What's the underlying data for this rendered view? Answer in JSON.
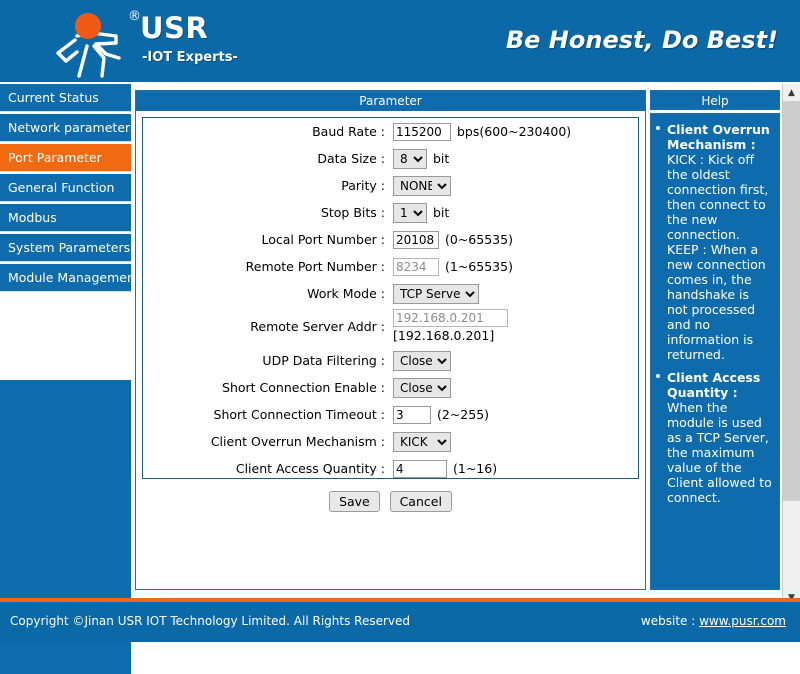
{
  "header": {
    "brand": "USR",
    "tagline": "-IOT Experts-",
    "slogan": "Be Honest, Do Best!",
    "logo_icon": "usr-running-man-logo",
    "registered_mark": "®",
    "bg_color": "#0c69a8"
  },
  "sidebar": {
    "items": [
      {
        "label": "Current Status",
        "active": false
      },
      {
        "label": "Network parameters",
        "active": false
      },
      {
        "label": "Port Parameter",
        "active": true
      },
      {
        "label": "General Function",
        "active": false
      },
      {
        "label": "Modbus",
        "active": false
      },
      {
        "label": "System Parameters",
        "active": false
      },
      {
        "label": "Module Management",
        "active": false
      }
    ],
    "active_color": "#f26a0f",
    "item_color": "#0f6cac"
  },
  "main": {
    "panel_title": "Parameter",
    "fields": [
      {
        "label": "Baud Rate :",
        "type": "text",
        "value": "115200",
        "hint": "bps(600~230400)",
        "disabled": false,
        "width": "w-baud"
      },
      {
        "label": "Data Size :",
        "type": "select",
        "value": "8",
        "hint": "bit",
        "width": "s-num"
      },
      {
        "label": "Parity :",
        "type": "select",
        "value": "NONE",
        "hint": "",
        "width": "s-mid"
      },
      {
        "label": "Stop Bits :",
        "type": "select",
        "value": "1",
        "hint": "bit",
        "width": "s-num"
      },
      {
        "label": "Local Port Number :",
        "type": "text",
        "value": "20108",
        "hint": "(0~65535)",
        "disabled": false,
        "width": "w-port"
      },
      {
        "label": "Remote Port Number :",
        "type": "text",
        "value": "8234",
        "hint": "(1~65535)",
        "disabled": true,
        "width": "w-port"
      },
      {
        "label": "Work Mode :",
        "type": "select",
        "value": "TCP Server",
        "hint": "",
        "width": "s-wide"
      },
      {
        "label": "Remote Server Addr :",
        "type": "addr",
        "value": "192.168.0.201",
        "note": "[192.168.0.201]",
        "disabled": true,
        "width": "w-addr"
      },
      {
        "label": "UDP Data Filtering :",
        "type": "select",
        "value": "Close",
        "hint": "",
        "width": "s-mid"
      },
      {
        "label": "Short Connection Enable :",
        "type": "select",
        "value": "Close",
        "hint": "",
        "width": "s-mid"
      },
      {
        "label": "Short Connection Timeout :",
        "type": "text",
        "value": "3",
        "hint": "(2~255)",
        "disabled": false,
        "width": "w-small"
      },
      {
        "label": "Client Overrun Mechanism :",
        "type": "select",
        "value": "KICK",
        "hint": "",
        "width": "s-mid"
      },
      {
        "label": "Client Access Quantity :",
        "type": "text",
        "value": "4",
        "hint": "(1~16)",
        "disabled": false,
        "width": "w-qty"
      }
    ],
    "save_label": "Save",
    "cancel_label": "Cancel"
  },
  "help": {
    "title": "Help",
    "groups": [
      {
        "heading": "Client Overrun Mechanism :",
        "body": "KICK : Kick off the oldest connection first, then connect to the new connection. KEEP : When a new connection comes in, the handshake is not processed and no information is returned."
      },
      {
        "heading": "Client Access Quantity :",
        "body": "When the module is used as a TCP Server, the maximum value of the Client allowed to connect."
      }
    ]
  },
  "scrollbar": {
    "up_icon": "chevron-up-icon",
    "down_icon": "chevron-down-icon"
  },
  "footer": {
    "copyright": "Copyright ©Jinan USR IOT Technology Limited. All Rights Reserved",
    "website_label": "website : ",
    "website_url": "www.pusr.com",
    "accent_color": "#f26a0f"
  }
}
